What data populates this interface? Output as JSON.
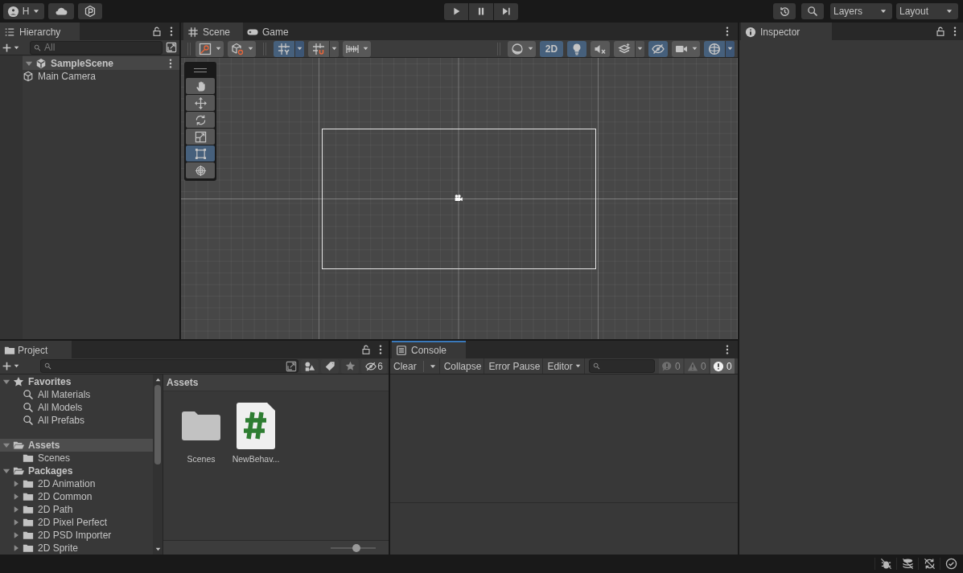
{
  "toolbar": {
    "account_initial": "H",
    "layers_dropdown": "Layers",
    "layout_dropdown": "Layout"
  },
  "hierarchy": {
    "title": "Hierarchy",
    "search": {
      "placeholder": "All"
    },
    "tree": [
      {
        "kind": "scene",
        "label": "SampleScene",
        "expanded": true,
        "children": [
          {
            "kind": "game_object",
            "label": "Main Camera"
          }
        ]
      }
    ]
  },
  "scene_view": {
    "tabs": [
      {
        "kind": "scene",
        "label": "Scene",
        "selected": true
      },
      {
        "kind": "game",
        "label": "Game",
        "selected": false
      }
    ],
    "left_tools": [
      {
        "kind": "orientation"
      },
      {
        "kind": "draw_mode"
      },
      {
        "kind": "grid_snap",
        "on": true
      },
      {
        "kind": "increment_snap",
        "on": false
      },
      {
        "kind": "grid"
      }
    ],
    "view_options": [
      {
        "kind": "shading"
      },
      {
        "kind": "mode_2d",
        "label": "2D",
        "on": true
      },
      {
        "kind": "lighting",
        "on": true
      },
      {
        "kind": "audio",
        "on": false
      },
      {
        "kind": "effects"
      },
      {
        "kind": "visibility",
        "on": true
      },
      {
        "kind": "camera"
      },
      {
        "kind": "gizmos",
        "on": true
      }
    ],
    "tools": [
      {
        "kind": "hand",
        "selected": false
      },
      {
        "kind": "move",
        "selected": false
      },
      {
        "kind": "rotate",
        "selected": false
      },
      {
        "kind": "scale",
        "selected": false
      },
      {
        "kind": "rect",
        "selected": true
      },
      {
        "kind": "transform",
        "selected": false
      }
    ]
  },
  "project": {
    "title": "Project",
    "hidden_packages_count": "6",
    "tree": [
      {
        "kind": "favorites",
        "label": "Favorites",
        "expanded": true,
        "selected": false,
        "children": [
          {
            "kind": "search",
            "label": "All Materials",
            "selected": false
          },
          {
            "kind": "search",
            "label": "All Models",
            "selected": false
          },
          {
            "kind": "search",
            "label": "All Prefabs",
            "selected": false
          }
        ]
      },
      {
        "kind": "folder",
        "label": "Assets",
        "expanded": true,
        "selected": true,
        "children": [
          {
            "kind": "folder",
            "label": "Scenes",
            "selected": false
          }
        ]
      },
      {
        "kind": "folder",
        "label": "Packages",
        "expanded": true,
        "selected": false,
        "children": [
          {
            "kind": "folder",
            "label": "2D Animation",
            "expanded": false,
            "selected": false
          },
          {
            "kind": "folder",
            "label": "2D Common",
            "expanded": false,
            "selected": false
          },
          {
            "kind": "folder",
            "label": "2D Path",
            "expanded": false,
            "selected": false
          },
          {
            "kind": "folder",
            "label": "2D Pixel Perfect",
            "expanded": false,
            "selected": false
          },
          {
            "kind": "folder",
            "label": "2D PSD Importer",
            "expanded": false,
            "selected": false
          },
          {
            "kind": "folder",
            "label": "2D Sprite",
            "expanded": false,
            "selected": false
          }
        ]
      }
    ],
    "breadcrumb": "Assets",
    "items": [
      {
        "kind": "folder",
        "label": "Scenes"
      },
      {
        "kind": "script",
        "label": "NewBehav..."
      }
    ],
    "zoom_slider": {
      "level": 0.58
    }
  },
  "console": {
    "title": "Console",
    "buttons": [
      {
        "kind": "split",
        "label": "Clear"
      },
      {
        "kind": "toggle",
        "label": "Collapse",
        "on": false
      },
      {
        "kind": "toggle",
        "label": "Error Pause",
        "on": false
      },
      {
        "kind": "dropdown",
        "label": "Editor"
      }
    ],
    "counts": [
      {
        "kind": "info",
        "count": "0",
        "on": false
      },
      {
        "kind": "warning",
        "count": "0",
        "on": false
      },
      {
        "kind": "error",
        "count": "0",
        "on": true
      }
    ]
  },
  "inspector": {
    "title": "Inspector"
  }
}
